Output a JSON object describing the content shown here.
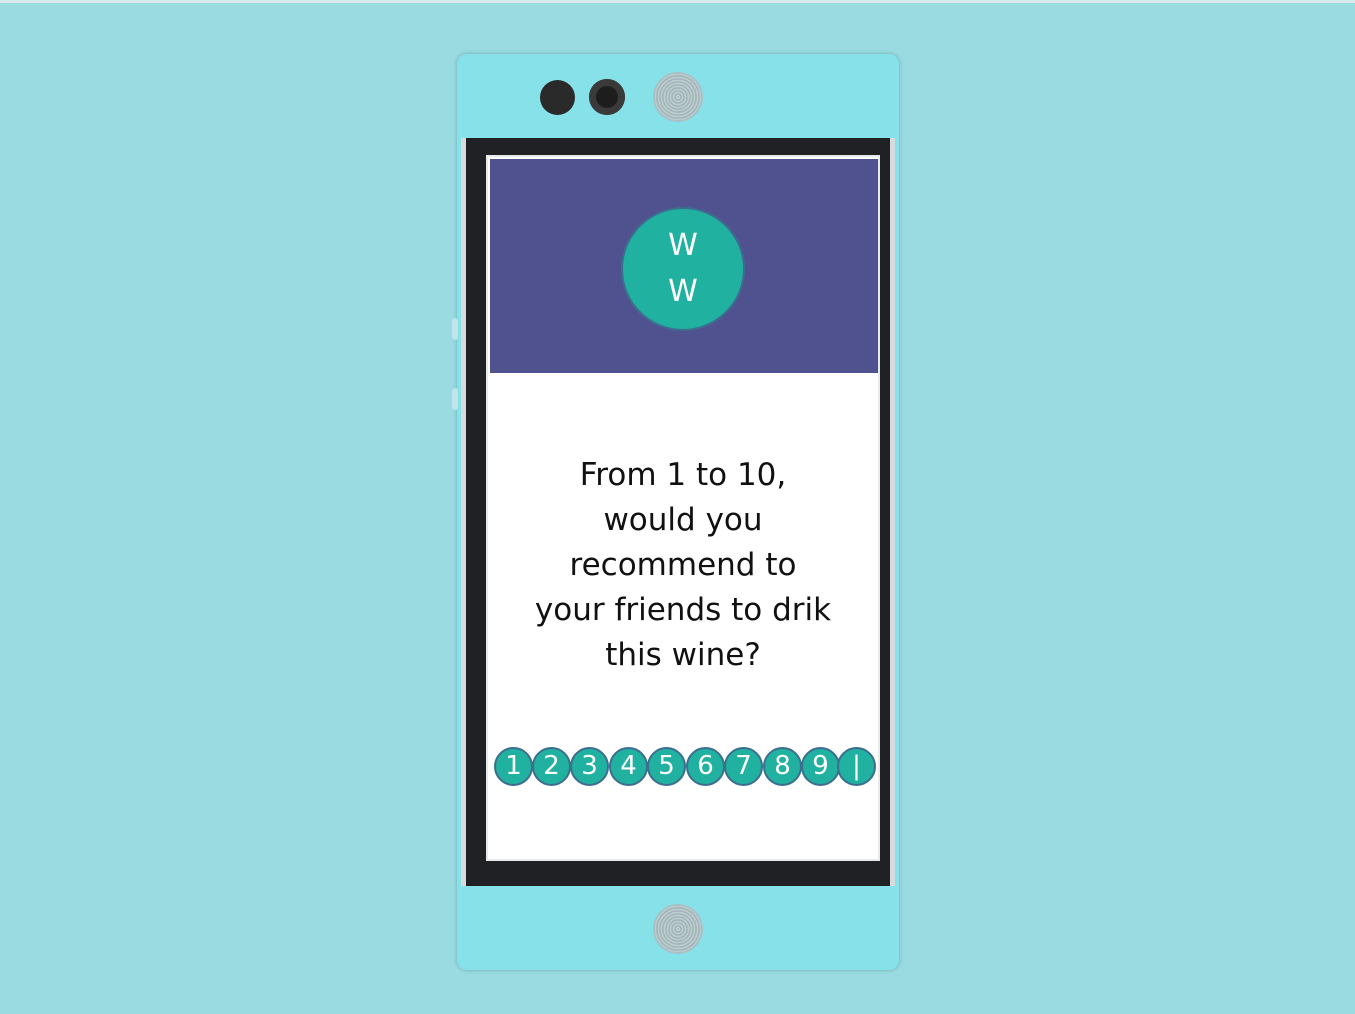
{
  "app": {
    "logo_line1": "W",
    "logo_line2": "W"
  },
  "survey": {
    "question_lines": [
      "From 1 to 10,",
      "would you",
      "recommend to",
      "your friends to drik",
      "this wine?"
    ],
    "rating_options": [
      "1",
      "2",
      "3",
      "4",
      "5",
      "6",
      "7",
      "8",
      "9",
      "|"
    ]
  },
  "colors": {
    "background": "#99dbe0",
    "phone_body": "#86e1e8",
    "header": "#50528f",
    "accent": "#20b1a0",
    "accent_border": "#3d6e8f"
  },
  "icons": {
    "front_camera": "camera-icon",
    "fingerprint_sensor": "fingerprint-icon"
  }
}
